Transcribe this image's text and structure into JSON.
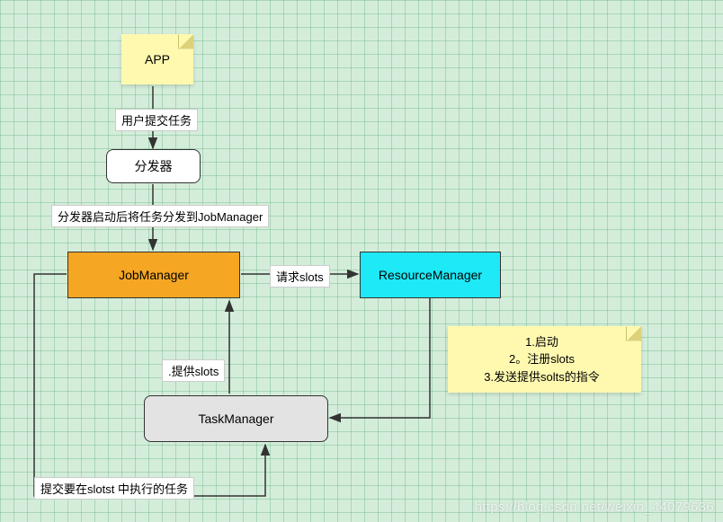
{
  "nodes": {
    "app": "APP",
    "dispatcher": "分发器",
    "jobManager": "JobManager",
    "resourceManager": "ResourceManager",
    "taskManager": "TaskManager"
  },
  "labels": {
    "userSubmit": "用户提交任务",
    "dispatcherStart": "分发器启动后将任务分发到JobManager",
    "requestSlots": "请求slots",
    "provideSlots": ".提供slots",
    "submitSlotTask": "提交要在slotst 中执行的任务"
  },
  "note": {
    "line1": "1.启动",
    "line2": "2。注册slots",
    "line3": "3.发送提供solts的指令"
  },
  "watermark": "https://blog.csdn.net/weixin_44079636"
}
